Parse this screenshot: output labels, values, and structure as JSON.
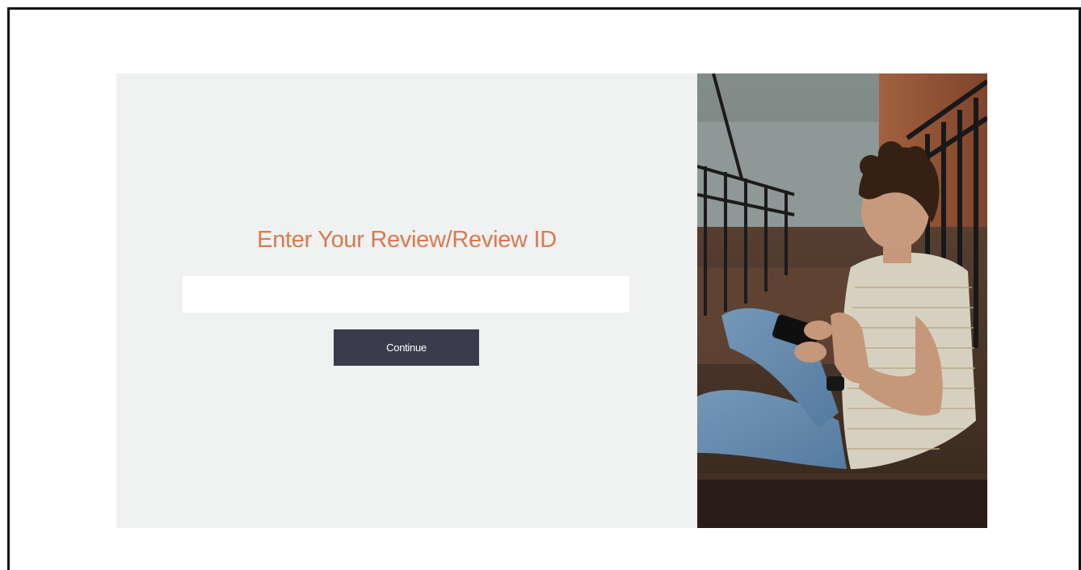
{
  "form": {
    "heading": "Enter Your Review/Review ID",
    "input_value": "",
    "input_placeholder": "",
    "continue_label": "Continue"
  },
  "photo": {
    "subject": "person-sitting-on-stairs-using-phone-photo"
  },
  "colors": {
    "heading": "#d97a4e",
    "panel_background": "#f0f1f1",
    "button_background": "#3a3b4c",
    "button_text": "#ffffff"
  }
}
